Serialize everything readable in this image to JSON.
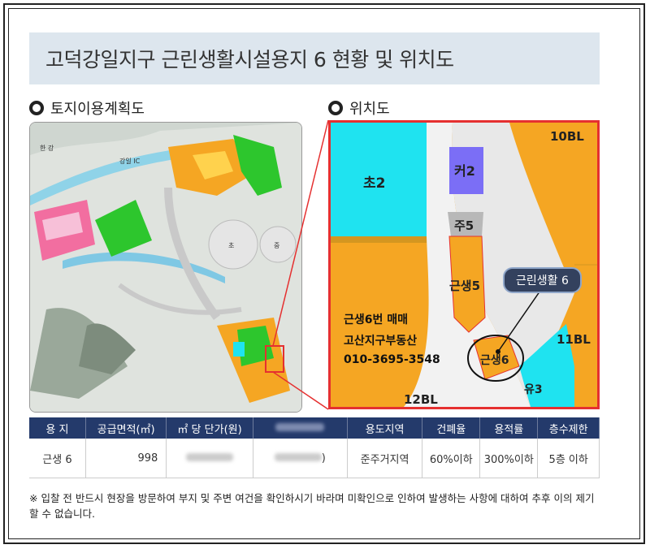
{
  "title": "고덕강일지구 근린생활시설용지 6 현황 및 위치도",
  "sections": {
    "left": "토지이용계획도",
    "right": "위치도"
  },
  "left_map": {
    "labels": [
      "한 강",
      "강일 IC",
      "초",
      "중"
    ]
  },
  "right_map": {
    "blocks": {
      "top_right": "10BL",
      "right": "11BL",
      "bottom": "12BL",
      "cho2": "초2",
      "keo2": "커2",
      "ju5": "주5",
      "geun5": "근생5",
      "geun6": "근생6",
      "yu3": "유3"
    },
    "callout": "근린생활 6",
    "notes": [
      "근생6번 매매",
      "고산지구부동산",
      "010-3695-3548"
    ]
  },
  "table": {
    "headers": [
      "용 지",
      "공급면적(㎡)",
      "㎡ 당 단가(원)",
      "",
      "용도지역",
      "건폐율",
      "용적률",
      "층수제한"
    ],
    "row": [
      "근생 6",
      "998",
      "",
      ")",
      "준주거지역",
      "60%이하",
      "300%이하",
      "5층 이하"
    ]
  },
  "footnote": "※ 입찰 전 반드시 현장을 방문하여 부지 및 주변 여건을 확인하시기 바라며 미확인으로 인하여 발생하는 사항에 대하여 추후 이의 제기할 수 없습니다.",
  "colors": {
    "header_bg": "#243a6b",
    "title_bg": "#dde6ee",
    "orange": "#f5a623",
    "cyan": "#1fe3f0",
    "purple": "#7b6ef6",
    "red": "#e53030"
  }
}
